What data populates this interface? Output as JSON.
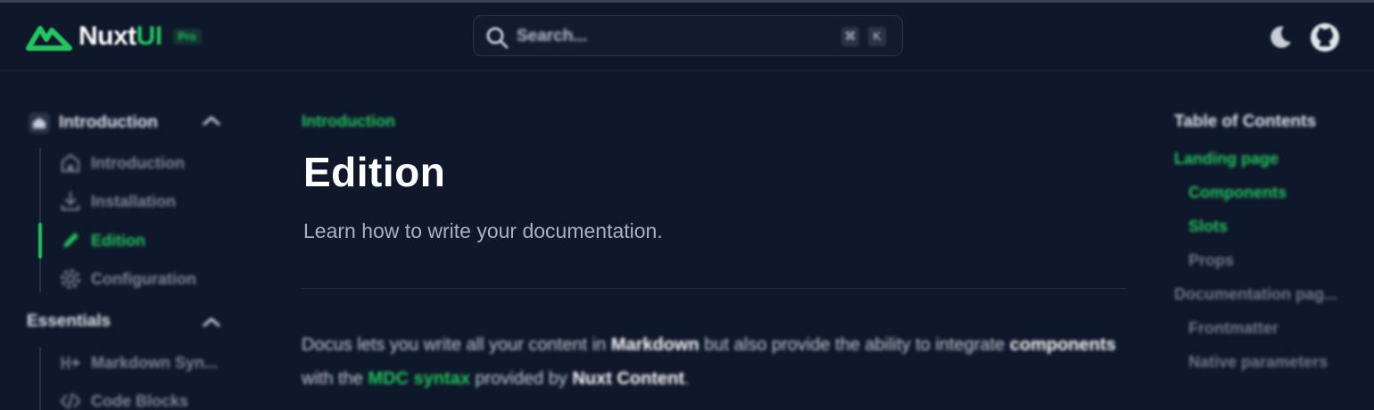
{
  "header": {
    "logo": {
      "text_main": "Nuxt",
      "text_accent": "UI",
      "badge": "Pro"
    },
    "search": {
      "placeholder": "Search...",
      "shortcut_keys": [
        "⌘",
        "K"
      ]
    },
    "icons": [
      "moon-icon",
      "github-icon"
    ]
  },
  "sidebar": {
    "sections": [
      {
        "title": "Introduction",
        "icon": "home-icon",
        "expanded": true,
        "items": [
          {
            "label": "Introduction",
            "icon": "home-icon",
            "active": false
          },
          {
            "label": "Installation",
            "icon": "download-icon",
            "active": false
          },
          {
            "label": "Edition",
            "icon": "pencil-icon",
            "active": true
          },
          {
            "label": "Configuration",
            "icon": "gear-icon",
            "active": false
          }
        ]
      },
      {
        "title": "Essentials",
        "expanded": true,
        "items": [
          {
            "label": "Markdown Syn...",
            "icon": "heading-icon",
            "active": false
          },
          {
            "label": "Code Blocks",
            "icon": "code-icon",
            "active": false
          }
        ]
      }
    ]
  },
  "main": {
    "breadcrumb": "Introduction",
    "title": "Edition",
    "description": "Learn how to write your documentation.",
    "paragraph": {
      "t1": "Docus lets you write all your content in ",
      "b1": "Markdown",
      "t2": " but also provide the ability to integrate ",
      "b2": "components",
      "t3": " with the ",
      "link": "MDC syntax",
      "t4": " provided by ",
      "b3": "Nuxt Content",
      "t5": "."
    }
  },
  "toc": {
    "title": "Table of Contents",
    "items": [
      {
        "label": "Landing page",
        "active": true
      },
      {
        "label": "Components",
        "active": true
      },
      {
        "label": "Slots",
        "active": true
      },
      {
        "label": "Props",
        "active": false
      },
      {
        "label": "Documentation pag...",
        "active": false
      },
      {
        "label": "Frontmatter",
        "active": false
      },
      {
        "label": "Native parameters",
        "active": false
      }
    ]
  },
  "colors": {
    "background": "#0f172a",
    "accent": "#22c55e",
    "text": "#ffffff",
    "muted": "#7d8899"
  }
}
